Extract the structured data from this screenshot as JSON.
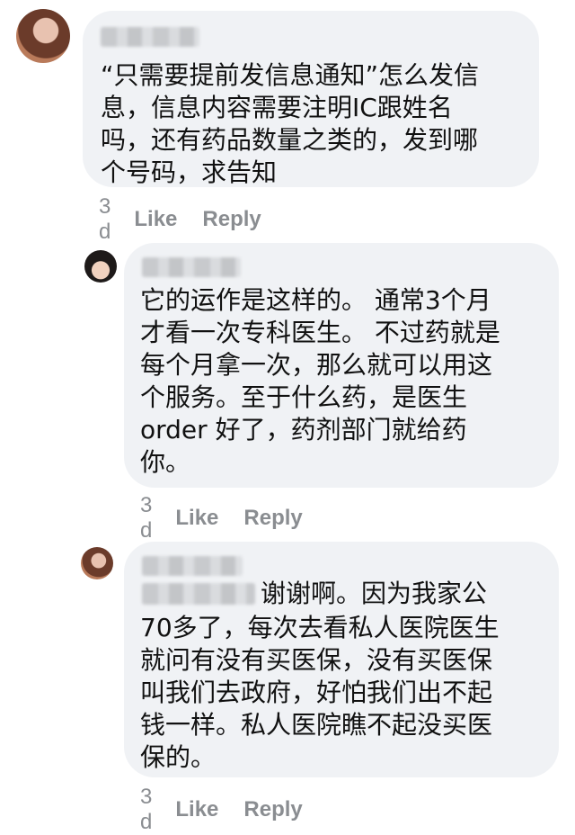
{
  "comments": [
    {
      "author": "",
      "text": "“只需要提前发信息通知”怎么发信\n息，信息内容需要注明IC跟姓名\n吗，还有药品数量之类的，发到哪\n个号码，求告知",
      "time": "3 d",
      "like_label": "Like",
      "reply_label": "Reply"
    },
    {
      "author": "",
      "text": "它的运作是这样的。 通常3个月\n才看一次专科医生。 不过药就是\n每个月拿一次，那么就可以用这\n个服务。至于什么药，是医生\norder 好了，药剂部门就给药\n你。",
      "time": "3 d",
      "like_label": "Like",
      "reply_label": "Reply"
    },
    {
      "author": "",
      "text_first_line": "谢谢啊。因为我家公",
      "text": "70多了，每次去看私人医院医生\n就问有没有买医保，没有买医保\n叫我们去政府，好怕我们出不起\n钱一样。私人医院瞧不起没买医\n保的。",
      "time": "3 d",
      "like_label": "Like",
      "reply_label": "Reply"
    }
  ]
}
